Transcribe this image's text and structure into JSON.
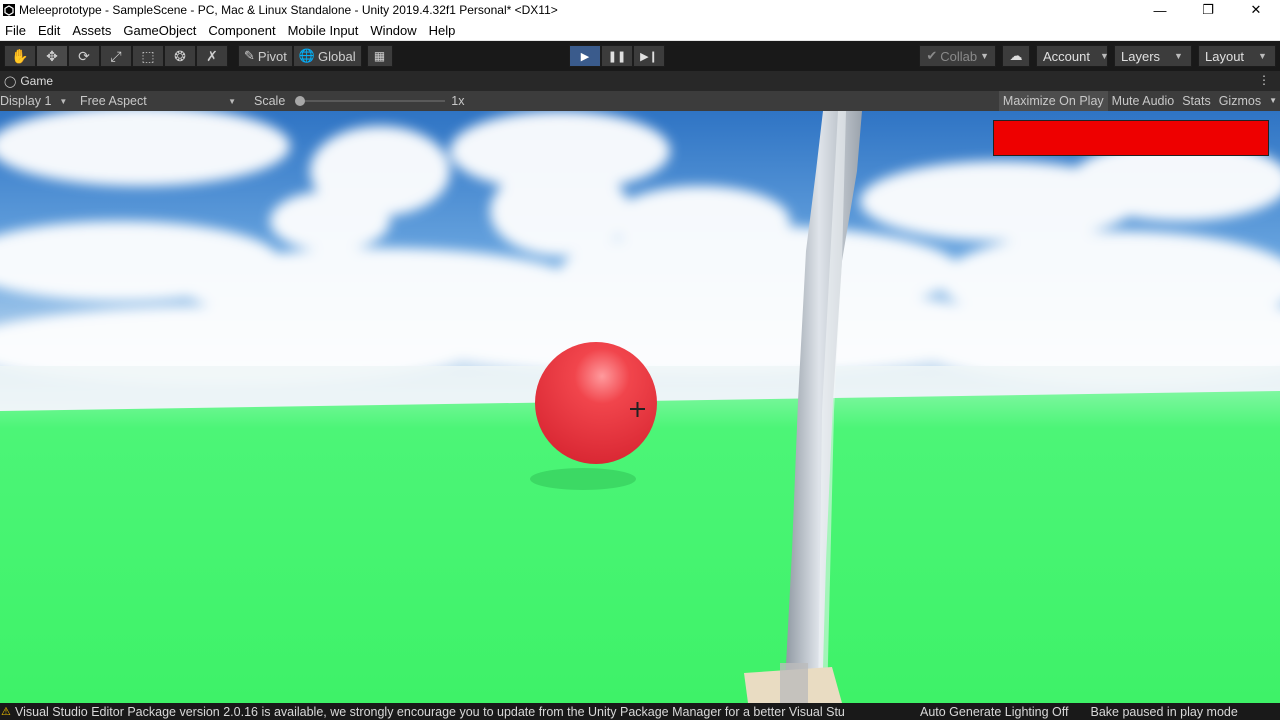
{
  "window": {
    "title": "Meleeprototype - SampleScene - PC, Mac & Linux Standalone - Unity 2019.4.32f1 Personal* <DX11>",
    "controls": [
      "minimize-icon",
      "restore-icon",
      "close-icon"
    ]
  },
  "menu": {
    "items": [
      "File",
      "Edit",
      "Assets",
      "GameObject",
      "Component",
      "Mobile Input",
      "Window",
      "Help"
    ]
  },
  "toolbar": {
    "transform_tools": [
      "hand-tool-icon",
      "move-tool-icon",
      "rotate-tool-icon",
      "scale-tool-icon",
      "rect-tool-icon",
      "transform-tool-icon",
      "custom-tool-icon"
    ],
    "pivot_label": "Pivot",
    "global_label": "Global",
    "collab_label": "Collab",
    "account_label": "Account",
    "layers_label": "Layers",
    "layout_label": "Layout"
  },
  "game_tab": {
    "label": "Game"
  },
  "game_bar": {
    "display": "Display 1",
    "aspect": "Free Aspect",
    "scale_label": "Scale",
    "scale_value": "1x",
    "maximize_on_play": "Maximize On Play",
    "mute_audio": "Mute Audio",
    "stats": "Stats",
    "gizmos": "Gizmos"
  },
  "scene": {
    "health_bar_color": "#ee0000",
    "health_fraction": 1.0,
    "sphere_color": "#e8323a",
    "ground_color": "#44f46e",
    "sky_color": "#3f86d4"
  },
  "status": {
    "message": "Visual Studio Editor Package version 2.0.16 is available, we strongly encourage you to update from the Unity Package Manager for a better Visual Stu",
    "lighting": "Auto Generate Lighting Off",
    "bake": "Bake paused in play mode"
  }
}
